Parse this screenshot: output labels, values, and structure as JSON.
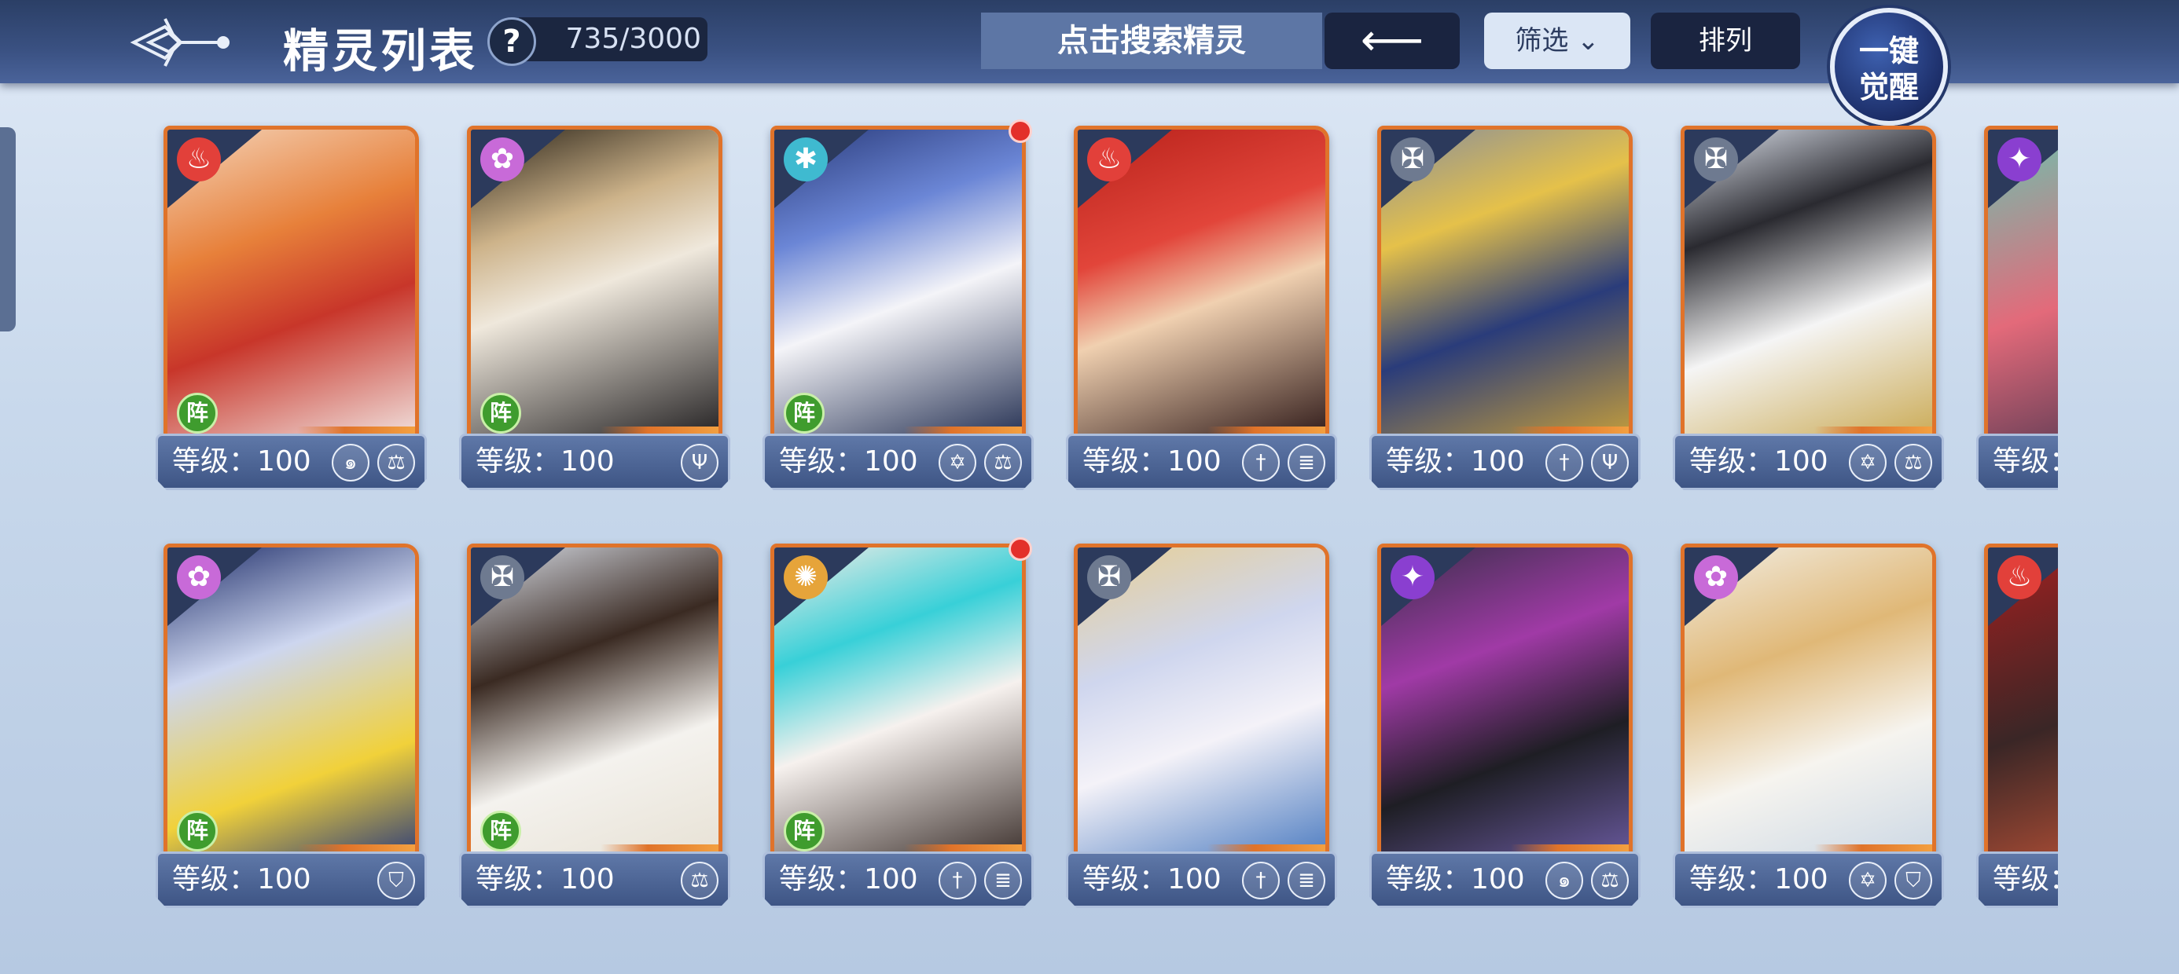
{
  "header": {
    "title": "精灵列表",
    "help_label": "?",
    "count": "735/3000",
    "search_placeholder": "点击搜索精灵",
    "back_label": "⟵",
    "filter_label": "筛选 ⌄",
    "sort_label": "排列",
    "awaken_line1": "一键",
    "awaken_line2": "觉醒"
  },
  "level_prefix": "等级：",
  "cards": [
    {
      "row": 0,
      "col": 0,
      "level": "等级：100",
      "element": "fire-icon",
      "formation": "阵",
      "roles": [
        "spiral-icon",
        "scale-icon"
      ],
      "new": false,
      "art": "linear-gradient(160deg,#f4d3b8 0%,#e7803a 35%,#c8362a 60%,#f2e7e4 100%)"
    },
    {
      "row": 0,
      "col": 1,
      "level": "等级：100",
      "element": "rainbow-icon",
      "formation": "阵",
      "roles": [
        "trident-icon"
      ],
      "new": false,
      "art": "linear-gradient(160deg,#2a2318 0%,#cdb38a 30%,#efe8dc 50%,#1d1b1d 100%)"
    },
    {
      "row": 0,
      "col": 2,
      "level": "等级：100",
      "element": "snowflake-icon",
      "formation": "阵",
      "roles": [
        "star-icon",
        "scale-icon"
      ],
      "new": true,
      "art": "linear-gradient(160deg,#2a3b7a 0%,#6b86d6 30%,#f4f4f8 55%,#1f2b4e 100%)"
    },
    {
      "row": 0,
      "col": 3,
      "level": "等级：100",
      "element": "fire-icon",
      "formation": "",
      "roles": [
        "sword-icon",
        "book-icon"
      ],
      "new": false,
      "art": "linear-gradient(160deg,#b8221b 0%,#e2453a 35%,#f0d0b0 55%,#2a1515 100%)"
    },
    {
      "row": 0,
      "col": 4,
      "level": "等级：100",
      "element": "neutral-icon",
      "formation": "",
      "roles": [
        "sword-icon",
        "trident-icon"
      ],
      "new": false,
      "art": "linear-gradient(160deg,#8a8f9a 0%,#e5c14a 30%,#2a3c7a 60%,#c8a03a 100%)"
    },
    {
      "row": 0,
      "col": 5,
      "level": "等级：100",
      "element": "neutral-icon",
      "formation": "",
      "roles": [
        "star-icon",
        "scale-icon"
      ],
      "new": false,
      "art": "linear-gradient(160deg,#dfe4ee 0%,#2a2a30 30%,#f5f5f5 60%,#c9a850 100%)"
    },
    {
      "row": 0,
      "col": 6,
      "level": "等级：",
      "element": "dark-icon",
      "formation": "",
      "roles": [],
      "new": false,
      "art": "linear-gradient(160deg,#6ac3b0 0%,#e36a7a 50%,#3a2f4a 100%)"
    },
    {
      "row": 1,
      "col": 0,
      "level": "等级：100",
      "element": "rainbow-icon",
      "formation": "阵",
      "roles": [
        "shield-icon"
      ],
      "new": false,
      "art": "linear-gradient(160deg,#1f2e6a 0%,#cdd6ef 35%,#f1d13a 70%,#2a3a7a 100%)"
    },
    {
      "row": 1,
      "col": 1,
      "level": "等级：100",
      "element": "neutral-icon",
      "formation": "阵",
      "roles": [
        "scale-icon"
      ],
      "new": false,
      "art": "linear-gradient(160deg,#d8dde6 0%,#3a2a22 35%,#f4f2ee 65%,#e7e1d4 100%)"
    },
    {
      "row": 1,
      "col": 2,
      "level": "等级：100",
      "element": "light-icon",
      "formation": "阵",
      "roles": [
        "sword-icon",
        "book-icon"
      ],
      "new": true,
      "art": "linear-gradient(160deg,#f3ece6 0%,#38d0d8 30%,#f6f1ee 55%,#3a2e2a 100%)"
    },
    {
      "row": 1,
      "col": 3,
      "level": "等级：100",
      "element": "neutral-icon",
      "formation": "",
      "roles": [
        "sword-icon",
        "book-icon"
      ],
      "new": false,
      "art": "linear-gradient(160deg,#e7cf95 0%,#cfd6ee 35%,#f4f2f8 60%,#4a7ac0 100%)"
    },
    {
      "row": 1,
      "col": 4,
      "level": "等级：100",
      "element": "dark-icon",
      "formation": "",
      "roles": [
        "spiral-icon",
        "scale-icon"
      ],
      "new": false,
      "art": "linear-gradient(160deg,#3a2f4a 0%,#a03aa6 35%,#1e1e24 65%,#6a5aa0 100%)"
    },
    {
      "row": 1,
      "col": 5,
      "level": "等级：100",
      "element": "rainbow-icon",
      "formation": "",
      "roles": [
        "star-icon",
        "shield-icon"
      ],
      "new": false,
      "art": "linear-gradient(160deg,#f2ede2 0%,#e0b877 35%,#f6f4ef 65%,#cbd7e4 100%)"
    },
    {
      "row": 1,
      "col": 6,
      "level": "等级：",
      "element": "fire-icon",
      "formation": "",
      "roles": [],
      "new": false,
      "art": "linear-gradient(160deg,#a32020 0%,#3a2626 50%,#d25a3a 100%)"
    }
  ],
  "icon_glyphs": {
    "fire-icon": "♨",
    "rainbow-icon": "✿",
    "snowflake-icon": "✱",
    "neutral-icon": "✠",
    "dark-icon": "✦",
    "light-icon": "✺",
    "spiral-icon": "๑",
    "scale-icon": "⚖",
    "trident-icon": "Ψ",
    "star-icon": "✡",
    "sword-icon": "†",
    "book-icon": "≣",
    "shield-icon": "⛉"
  },
  "element_colors": {
    "fire-icon": "#e2403a",
    "rainbow-icon": "#c86ad8",
    "snowflake-icon": "#3fbad0",
    "neutral-icon": "#6e7a90",
    "dark-icon": "#8a3fd0",
    "light-icon": "#e6a43a"
  }
}
